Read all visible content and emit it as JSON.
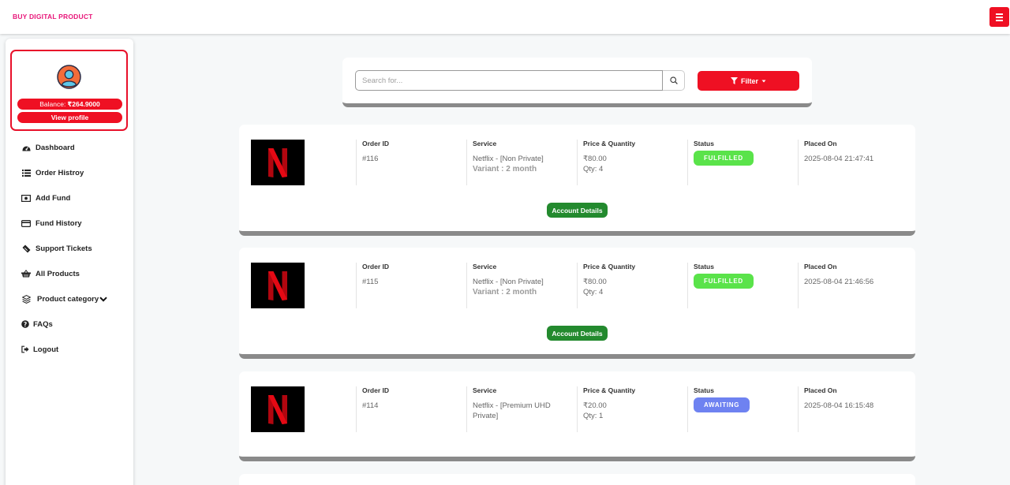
{
  "header": {
    "brand": "BUY DIGITAL PRODUCT"
  },
  "sidebar": {
    "balance_label": "Balance:",
    "balance_value": "₹264.9000",
    "view_profile": "View profile",
    "items": [
      {
        "label": "Dashboard",
        "icon": "dashboard-icon"
      },
      {
        "label": "Order Histroy",
        "icon": "list-icon"
      },
      {
        "label": "Add Fund",
        "icon": "money-icon"
      },
      {
        "label": "Fund History",
        "icon": "credit-card-icon"
      },
      {
        "label": "Support Tickets",
        "icon": "ticket-icon"
      },
      {
        "label": "All Products",
        "icon": "basket-icon"
      },
      {
        "label": "Product category",
        "icon": "layers-icon"
      },
      {
        "label": "FAQs",
        "icon": "question-icon"
      },
      {
        "label": "Logout",
        "icon": "logout-icon"
      }
    ]
  },
  "search": {
    "placeholder": "Search for...",
    "filter_label": "Filter"
  },
  "columns": {
    "order_id": "Order ID",
    "service": "Service",
    "price_qty": "Price & Quantity",
    "status": "Status",
    "placed_on": "Placed On"
  },
  "orders": [
    {
      "id": "#116",
      "service": "Netflix - [Non Private]",
      "variant": "Variant : 2 month",
      "price": "₹80.00",
      "qty": "Qty: 4",
      "status": "FULFILLED",
      "placed_on": "2025-08-04 21:47:41",
      "action": "Account Details"
    },
    {
      "id": "#115",
      "service": "Netflix - [Non Private]",
      "variant": "Variant : 2 month",
      "price": "₹80.00",
      "qty": "Qty: 4",
      "status": "FULFILLED",
      "placed_on": "2025-08-04 21:46:56",
      "action": "Account Details"
    },
    {
      "id": "#114",
      "service_line1": "Netflix - [Premium UHD",
      "service_line2": "Private]",
      "price": "₹20.00",
      "qty": "Qty: 1",
      "status": "AWAITING",
      "placed_on": "2025-08-04 16:15:48"
    }
  ],
  "colors": {
    "accent": "#ef1023",
    "brand": "#e8177a",
    "fulfilled": "#5ae34a",
    "awaiting": "#6e82f1",
    "account_details": "#238a2e"
  }
}
